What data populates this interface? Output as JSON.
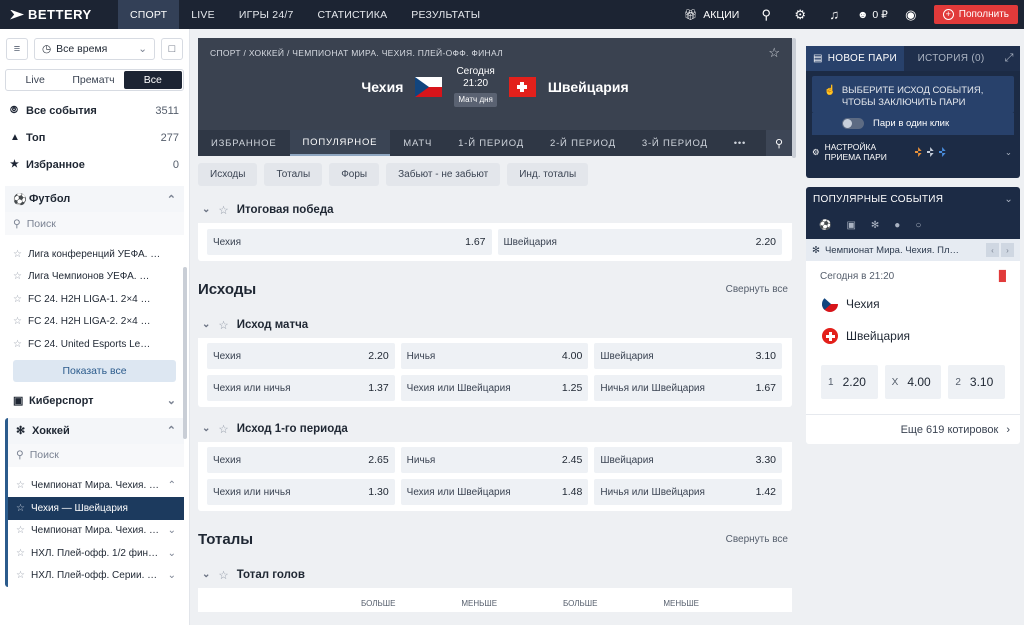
{
  "brand": {
    "logo_text": "BETTERY"
  },
  "topnav": {
    "items": [
      {
        "label": "СПОРТ",
        "active": true
      },
      {
        "label": "LIVE"
      },
      {
        "label": "ИГРЫ 24/7"
      },
      {
        "label": "СТАТИСТИКА"
      },
      {
        "label": "РЕЗУЛЬТАТЫ"
      }
    ],
    "promo_label": "АКЦИИ",
    "balance": "0 ₽",
    "deposit_label": "Пополнить"
  },
  "sidebar": {
    "time_filter": "Все время",
    "modes": [
      "Live",
      "Прематч",
      "Все"
    ],
    "summary": [
      {
        "label": "Все события",
        "count": "3511",
        "icon": "compass-icon"
      },
      {
        "label": "Топ",
        "count": "277",
        "icon": "flame-icon"
      },
      {
        "label": "Избранное",
        "count": "0",
        "icon": "star-icon"
      }
    ],
    "football": {
      "title": "Футбол",
      "search_placeholder": "Поиск",
      "leagues": [
        "Лига конференций УЕФА. …",
        "Лига Чемпионов УЕФА. …",
        "FC 24. H2H LIGA-1. 2×4 …",
        "FC 24. H2H LIGA-2. 2×4 …",
        "FC 24. United Esports Le…"
      ],
      "show_all": "Показать все"
    },
    "esports": {
      "title": "Киберспорт"
    },
    "hockey": {
      "title": "Хоккей",
      "search_placeholder": "Поиск",
      "leagues": [
        "Чемпионат Мира. Чехия. …",
        "Чехия — Швейцария",
        "Чемпионат Мира. Чехия. …",
        "НХЛ. Плей-офф. 1/2 фин…",
        "НХЛ. Плей-офф. Серии. …"
      ]
    }
  },
  "match": {
    "breadcrumb": "СПОРТ / ХОККЕЙ / ЧЕМПИОНАТ МИРА. ЧЕХИЯ. ПЛЕЙ-ОФФ. ФИНАЛ",
    "home": "Чехия",
    "away": "Швейцария",
    "day": "Сегодня",
    "time": "21:20",
    "badge": "Матч дня",
    "tabs": [
      "ИЗБРАННОЕ",
      "ПОПУЛЯРНОЕ",
      "МАТЧ",
      "1-Й ПЕРИОД",
      "2-Й ПЕРИОД",
      "3-Й ПЕРИОД",
      "•••"
    ],
    "chips": [
      "Исходы",
      "Тоталы",
      "Форы",
      "Забьют - не забьют",
      "Инд. тоталы"
    ]
  },
  "markets": {
    "winner": {
      "title": "Итоговая победа",
      "odds": [
        {
          "label": "Чехия",
          "value": "1.67"
        },
        {
          "label": "Швейцария",
          "value": "2.20"
        }
      ]
    },
    "outcomes_section": {
      "title": "Исходы",
      "collapse": "Свернуть все"
    },
    "match_result": {
      "title": "Исход матча",
      "rows": [
        [
          {
            "label": "Чехия",
            "value": "2.20"
          },
          {
            "label": "Ничья",
            "value": "4.00"
          },
          {
            "label": "Швейцария",
            "value": "3.10"
          }
        ],
        [
          {
            "label": "Чехия или ничья",
            "value": "1.37"
          },
          {
            "label": "Чехия или Швейцария",
            "value": "1.25"
          },
          {
            "label": "Ничья или Швейцария",
            "value": "1.67"
          }
        ]
      ]
    },
    "period1_result": {
      "title": "Исход 1-го периода",
      "rows": [
        [
          {
            "label": "Чехия",
            "value": "2.65"
          },
          {
            "label": "Ничья",
            "value": "2.45"
          },
          {
            "label": "Швейцария",
            "value": "3.30"
          }
        ],
        [
          {
            "label": "Чехия или ничья",
            "value": "1.30"
          },
          {
            "label": "Чехия или Швейцария",
            "value": "1.48"
          },
          {
            "label": "Ничья или Швейцария",
            "value": "1.42"
          }
        ]
      ]
    },
    "totals_section": {
      "title": "Тоталы",
      "collapse": "Свернуть все"
    },
    "total_goals": {
      "title": "Тотал голов",
      "cols": [
        "БОЛЬШЕ",
        "МЕНЬШЕ",
        "БОЛЬШЕ",
        "МЕНЬШЕ"
      ]
    }
  },
  "betslip": {
    "tab_new": "НОВОЕ ПАРИ",
    "tab_history": "ИСТОРИЯ (0)",
    "hint": "ВЫБЕРИТЕ ИСХОД СОБЫТИЯ, ЧТОБЫ ЗАКЛЮЧИТЬ ПАРИ",
    "one_click": "Пари в один клик",
    "settings": "НАСТРОЙКА ПРИЕМА ПАРИ"
  },
  "popular": {
    "title": "ПОПУЛЯРНЫЕ СОБЫТИЯ",
    "league": "Чемпионат Мира. Чехия. Пл…",
    "date": "Сегодня в 21:20",
    "home": "Чехия",
    "away": "Швейцария",
    "odds": [
      {
        "key": "1",
        "value": "2.20"
      },
      {
        "key": "X",
        "value": "4.00"
      },
      {
        "key": "2",
        "value": "3.10"
      }
    ],
    "more": "Еще 619 котировок"
  },
  "colors": {
    "nav_bg": "#1c2433",
    "accent_red": "#e13a3a",
    "betslip_bg": "#1c2b45"
  }
}
